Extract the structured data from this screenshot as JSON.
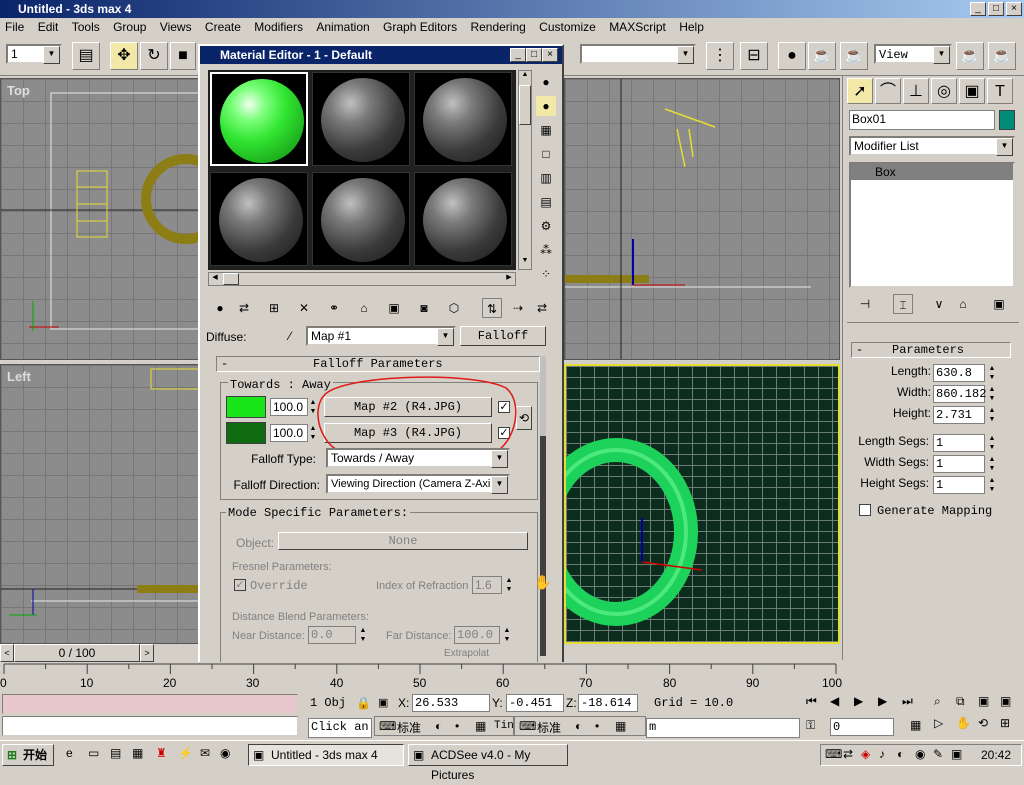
{
  "app": {
    "title": "Untitled - 3ds max 4",
    "window_controls": [
      "_",
      "□",
      "×"
    ]
  },
  "menu": [
    "File",
    "Edit",
    "Tools",
    "Group",
    "Views",
    "Create",
    "Modifiers",
    "Animation",
    "Graph Editors",
    "Rendering",
    "Customize",
    "MAXScript",
    "Help"
  ],
  "toolbar": {
    "selection_filter_value": "1",
    "view_dropdown_value": "View"
  },
  "viewports": {
    "top_label": "Top",
    "left_label": "Left"
  },
  "material_editor": {
    "title": "Material Editor - 1 - Default",
    "diffuse_label": "Diffuse:",
    "map_dropdown_value": "Map #1",
    "map_type_button": "Falloff",
    "falloff_rollout_title": "Falloff Parameters",
    "falloff_rollout_toggle": "-",
    "towards_away_label": "Towards : Away",
    "row1": {
      "amount": "100.0",
      "map": "Map #2  (R4.JPG)",
      "checked": true,
      "color": "#19e619"
    },
    "row2": {
      "amount": "100.0",
      "map": "Map #3  (R4.JPG)",
      "checked": true,
      "color": "#0e6b12"
    },
    "falloff_type_label": "Falloff Type:",
    "falloff_type_value": "Towards / Away",
    "falloff_direction_label": "Falloff Direction:",
    "falloff_direction_value": "Viewing Direction (Camera Z-Axis)",
    "mode_specific_title": "Mode Specific Parameters:",
    "object_label": "Object:",
    "object_value": "None",
    "fresnel_title": "Fresnel Parameters:",
    "override_label": "Override",
    "ior_label": "Index of Refraction",
    "ior_value": "1.6",
    "distance_blend_title": "Distance Blend Parameters:",
    "near_label": "Near Distance:",
    "near_value": "0.0",
    "far_label": "Far Distance:",
    "far_value": "100.0",
    "extrapolate_label": "Extrapolat"
  },
  "command_panel": {
    "object_name": "Box01",
    "object_color": "#008c78",
    "modifier_list": "Modifier List",
    "stack_item": "Box",
    "parameters_title": "Parameters",
    "params": [
      {
        "label": "Length:",
        "value": "630.8"
      },
      {
        "label": "Width:",
        "value": "860.182"
      },
      {
        "label": "Height:",
        "value": "2.731"
      }
    ],
    "segs": [
      {
        "label": "Length Segs:",
        "value": "1"
      },
      {
        "label": "Width Segs:",
        "value": "1"
      },
      {
        "label": "Height Segs:",
        "value": "1"
      }
    ],
    "generate_mapping": "Generate Mapping"
  },
  "timeline": {
    "frame": "0 / 100",
    "ticks": [
      "0",
      "10",
      "20",
      "30",
      "40",
      "50",
      "60",
      "70",
      "80",
      "90",
      "100"
    ]
  },
  "status": {
    "selection": "1 Obj",
    "x_label": "X:",
    "x_value": "26.533",
    "y_label": "Y:",
    "y_value": "-0.451",
    "z_label": "Z:",
    "z_value": "-18.614",
    "grid": "Grid = 10.0",
    "prompt": "Click an",
    "prompt_tail": "Tin",
    "ime_label": "标准",
    "frame_value": "0",
    "script_text": "m"
  },
  "taskbar": {
    "start": "开始",
    "tasks": [
      "Untitled - 3ds max 4",
      "ACDSee v4.0 - My Pictures"
    ],
    "clock": "20:42"
  }
}
